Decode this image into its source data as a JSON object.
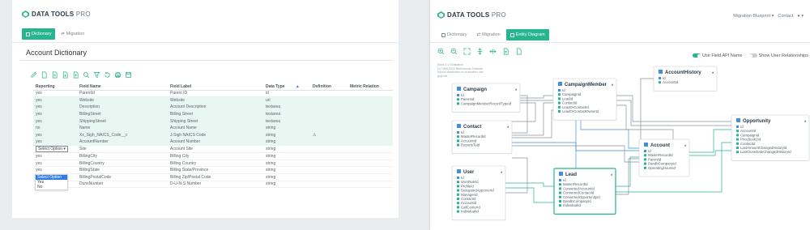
{
  "brand": {
    "name": "DATA TOOLS",
    "suffix": "PRO"
  },
  "left": {
    "tabs": [
      {
        "label": "Dictionary",
        "active": true
      },
      {
        "label": "Migration",
        "active": false
      }
    ],
    "title": "Account Dictionary",
    "columns": [
      "Reporting",
      "Field Name",
      "Field Label",
      "Data Type",
      "Definition",
      "Metric Relation"
    ],
    "rows": [
      [
        "yes",
        "ParentId",
        "Parent ID",
        "id",
        "",
        ""
      ],
      [
        "yes",
        "Website",
        "Website",
        "url",
        "",
        ""
      ],
      [
        "yes",
        "Description",
        "Account Description",
        "textarea",
        "",
        ""
      ],
      [
        "yes",
        "BillingStreet",
        "Billing Street",
        "textarea",
        "",
        ""
      ],
      [
        "yes",
        "ShippingStreet",
        "Shipping Street",
        "textarea",
        "",
        ""
      ],
      [
        "no",
        "Name",
        "Account Name",
        "string",
        "",
        ""
      ],
      [
        "yes",
        "Xx_Sigh_NAICS_Code__c",
        "J-Sigh NAICS Code",
        "string",
        "⚠",
        ""
      ],
      [
        "yes",
        "AccountNumber",
        "Account Number",
        "string",
        "",
        ""
      ],
      [
        "",
        "Site",
        "Account Site",
        "string",
        "",
        ""
      ],
      [
        "yes",
        "BillingCity",
        "Billing City",
        "string",
        "",
        ""
      ],
      [
        "yes",
        "BillingCountry",
        "Billing Country",
        "string",
        "",
        ""
      ],
      [
        "yes",
        "BillingState",
        "Billing State/Province",
        "string",
        "",
        ""
      ],
      [
        "yes",
        "BillingPostalCode",
        "Billing Zip/Postal Code",
        "string",
        "",
        ""
      ],
      [
        "yes",
        "DunsNumber",
        "D-U-N-S Number",
        "string",
        "",
        ""
      ]
    ],
    "dropdown": {
      "selected": "Select Option",
      "options": [
        "Select Option",
        "Yes",
        "No"
      ]
    }
  },
  "right": {
    "topnav": {
      "org": "Migration Blueprint",
      "contact": "Contact"
    },
    "tabs": [
      {
        "label": "Dictionary",
        "active": false
      },
      {
        "label": "Migration",
        "active": false
      },
      {
        "label": "Entity Diagram",
        "active": true
      }
    ],
    "toggles": [
      {
        "label": "Use Field API Name",
        "on": true
      },
      {
        "label": "Show User Relationships",
        "on": false
      }
    ],
    "meta": [
      "Stack 1.0 Evaluation",
      "(c) 1999-2024 Northwoods Software",
      "Not for distribution or production use",
      "gojs.net"
    ],
    "entities": [
      {
        "name": "Campaign",
        "fields": [
          "Id",
          "ParentId",
          "CampaignMemberRecordTypeId"
        ]
      },
      {
        "name": "CampaignMember",
        "fields": [
          "Id",
          "CampaignId",
          "LeadId",
          "ContactId",
          "LeadOrContactId",
          "LeadOrContactOwnerId"
        ]
      },
      {
        "name": "AccountHistory",
        "fields": [
          "Id",
          "AccountId"
        ]
      },
      {
        "name": "Contact",
        "fields": [
          "Id",
          "MasterRecordId",
          "AccountId",
          "ReportsToId"
        ]
      },
      {
        "name": "Account",
        "fields": [
          "Id",
          "MasterRecordId",
          "ParentId",
          "DandbCompanyId",
          "OperatingHoursId"
        ]
      },
      {
        "name": "Opportunity",
        "fields": [
          "Id",
          "AccountId",
          "CampaignId",
          "Pricebook2Id",
          "ContactId",
          "LastAmountChangedHistoryId",
          "LastCloseDateChangedHistoryId"
        ]
      },
      {
        "name": "User",
        "fields": [
          "Id",
          "UserRoleId",
          "ProfileId",
          "DelegatedApproverId",
          "ManagerId",
          "ContactId",
          "AccountId",
          "CallCenterId",
          "IndividualId"
        ]
      },
      {
        "name": "Lead",
        "fields": [
          "Id",
          "MasterRecordId",
          "ConvertedAccountId",
          "ConvertedContactId",
          "ConvertedOpportunityId",
          "DandbCompanyId",
          "IndividualId"
        ]
      }
    ]
  },
  "colors": {
    "accent": "#27b58f",
    "highlight": "#e7f7f2",
    "link_blue": "#3f8fdc"
  }
}
